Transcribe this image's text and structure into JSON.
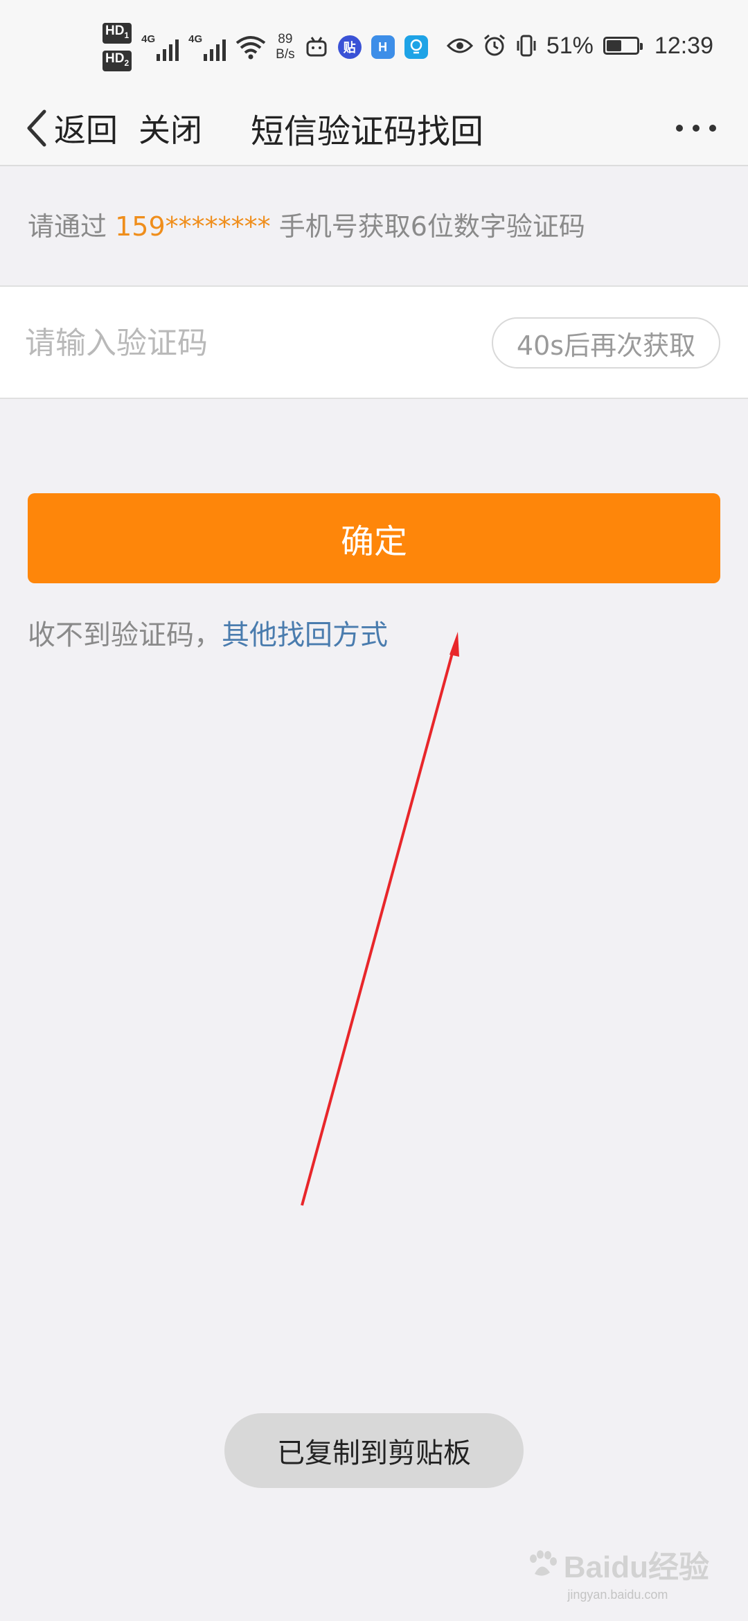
{
  "status_bar": {
    "hd1": "HD",
    "hd1_sub": "1",
    "hd2": "HD",
    "hd2_sub": "2",
    "net1": "4G",
    "net2": "4G",
    "speed_value": "89",
    "speed_unit": "B/s",
    "battery": "51%",
    "battery_level": 0.51,
    "time": "12:39",
    "icons": [
      "hd-icon",
      "signal-icon",
      "wifi-icon",
      "bilibili-icon",
      "tieba-icon",
      "app-icon",
      "bulb-icon",
      "eye-icon",
      "alarm-icon",
      "vibrate-icon",
      "battery-icon"
    ]
  },
  "nav": {
    "back_label": "返回",
    "close_label": "关闭",
    "title": "短信验证码找回"
  },
  "hint": {
    "prefix": "请通过 ",
    "phone": "159********",
    "suffix": " 手机号获取6位数字验证码"
  },
  "code_input": {
    "placeholder": "请输入验证码",
    "value": ""
  },
  "resend_label": "40s后再次获取",
  "confirm_label": "确定",
  "alt": {
    "prefix": "收不到验证码，",
    "link": "其他找回方式"
  },
  "toast": "已复制到剪贴板",
  "watermark": {
    "logo": "Baidu经验",
    "url": "jingyan.baidu.com"
  },
  "colors": {
    "accent_orange": "#fe860a",
    "phone_orange": "#ef8e1c",
    "link_blue": "#4a7cae",
    "annotation_red": "#e8262a"
  }
}
